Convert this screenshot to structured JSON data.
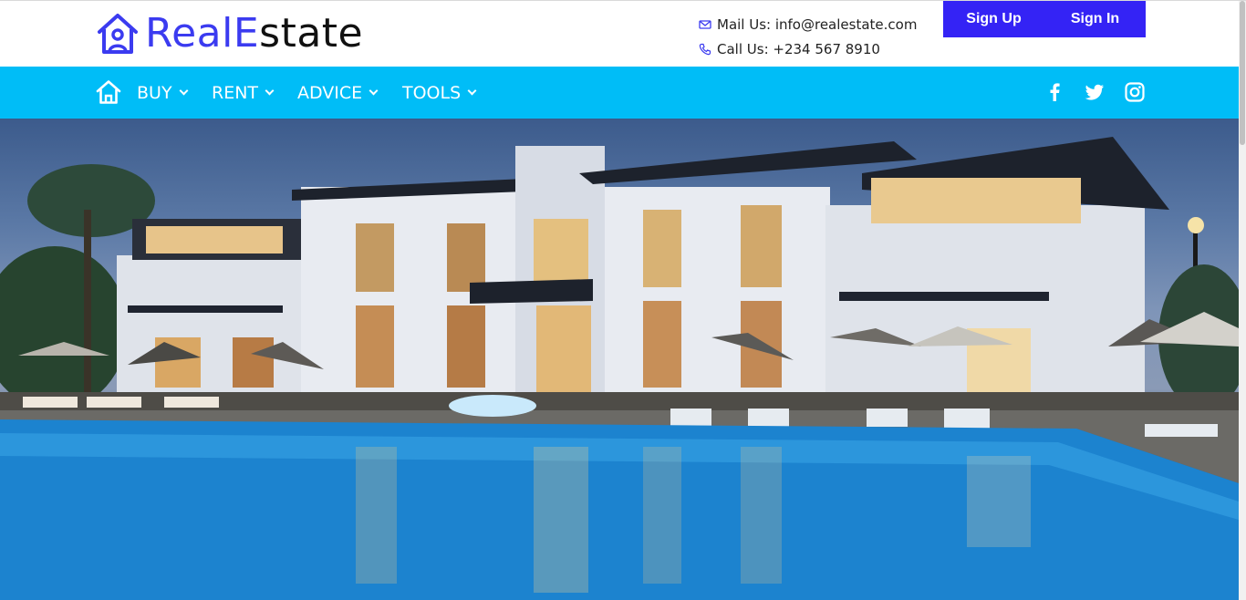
{
  "brand": {
    "part1": "RealE",
    "part2": "state",
    "accent": "#3b3bf0"
  },
  "contact": {
    "mail": "Mail Us: info@realestate.com",
    "phone": "Call Us: +234 567 8910"
  },
  "auth": {
    "signup": "Sign Up",
    "signin": "Sign In",
    "color": "#3423f5"
  },
  "nav": {
    "color": "#00bdf7",
    "items": [
      {
        "label": "BUY"
      },
      {
        "label": "RENT"
      },
      {
        "label": "ADVICE"
      },
      {
        "label": "TOOLS"
      }
    ]
  },
  "social": [
    "facebook-icon",
    "twitter-icon",
    "instagram-icon"
  ],
  "hero": {
    "image": "luxury villa with swimming pool at dusk"
  }
}
